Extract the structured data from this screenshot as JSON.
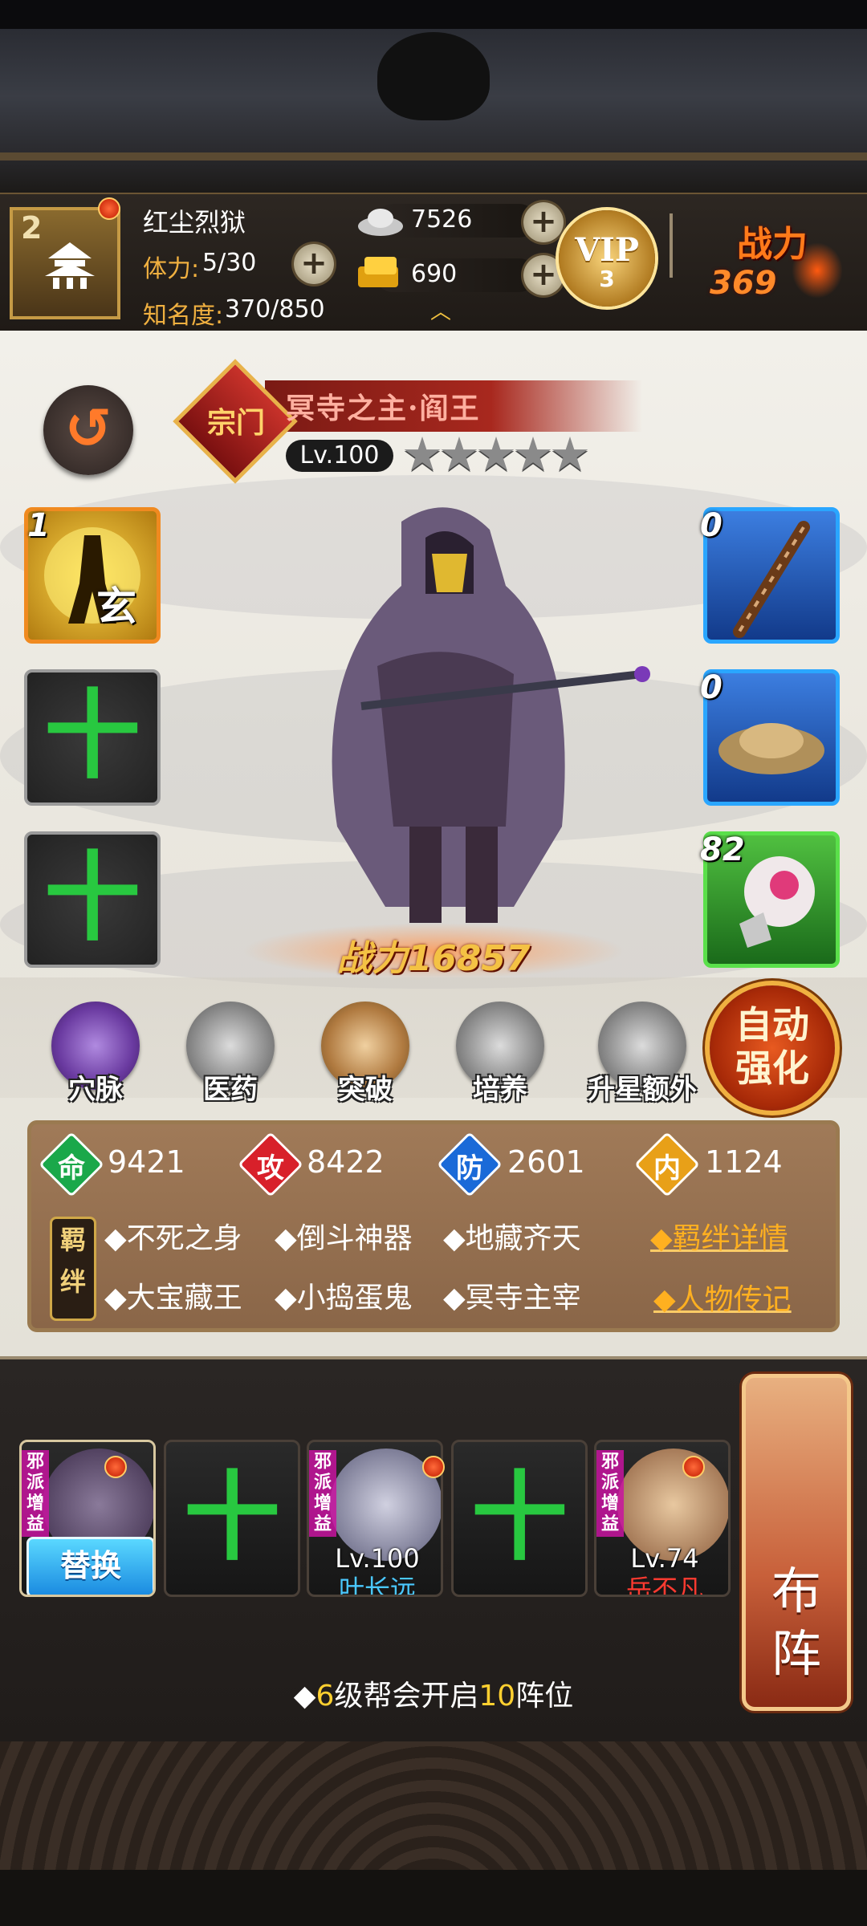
{
  "player": {
    "level": "2",
    "name": "红尘烈狱",
    "stamina_label": "体力:",
    "stamina_value": "5/30",
    "fame_label": "知名度:",
    "fame_value": "370/850"
  },
  "currency": {
    "silver": "7526",
    "gold": "690"
  },
  "vip": {
    "label": "VIP",
    "level": "3"
  },
  "combat_power_top": {
    "label": "战力",
    "value": "369"
  },
  "hero": {
    "rank_badge": "宗门",
    "name": "冥寺之主·阎王",
    "level": "Lv.100",
    "stars": 5,
    "stars_text": "★★★★★",
    "power": "战力16857"
  },
  "left_slots": [
    {
      "count": "1",
      "type": "skill",
      "glyph": "玄"
    },
    {
      "type": "empty",
      "plus": "十"
    },
    {
      "type": "empty",
      "plus": "十"
    }
  ],
  "right_slots": [
    {
      "count": "0",
      "type": "weapon"
    },
    {
      "count": "0",
      "type": "hat"
    },
    {
      "count": "82",
      "type": "treasure"
    }
  ],
  "functions": [
    {
      "label": "穴脉"
    },
    {
      "label": "医药"
    },
    {
      "label": "突破"
    },
    {
      "label": "培养"
    },
    {
      "label": "升星额外"
    }
  ],
  "auto_strengthen": {
    "line1": "自动",
    "line2": "强化"
  },
  "stats": [
    {
      "key": "命",
      "value": "9421",
      "color": "#1aa84a"
    },
    {
      "key": "攻",
      "value": "8422",
      "color": "#d8202a"
    },
    {
      "key": "防",
      "value": "2601",
      "color": "#1a6ad8"
    },
    {
      "key": "内",
      "value": "1124",
      "color": "#e8a018"
    }
  ],
  "bonds": {
    "tag": "羁绊",
    "items": [
      "◆不死之身",
      "◆倒斗神器",
      "◆地藏齐天",
      "◆大宝藏王",
      "◆小捣蛋鬼",
      "◆冥寺主宰"
    ],
    "detail_link": "◆羁绊详情",
    "bio_link": "◆人物传记"
  },
  "lineup": {
    "replace_label": "替换",
    "evil_tag": "邪派增益",
    "members": [
      {
        "state": "current"
      },
      {
        "state": "empty",
        "plus": "十"
      },
      {
        "state": "hero",
        "level": "Lv.100",
        "name": "叶长远",
        "name_color": "#4ac8ff"
      },
      {
        "state": "empty",
        "plus": "十"
      },
      {
        "state": "hero",
        "level": "Lv.74",
        "name": "岳不凡",
        "name_color": "#ff3a30"
      }
    ],
    "formation_label_1": "布",
    "formation_label_2": "阵",
    "hint_prefix": "◆",
    "hint_num1": "6",
    "hint_mid": "级帮会开启",
    "hint_num2": "10",
    "hint_suffix": "阵位"
  }
}
